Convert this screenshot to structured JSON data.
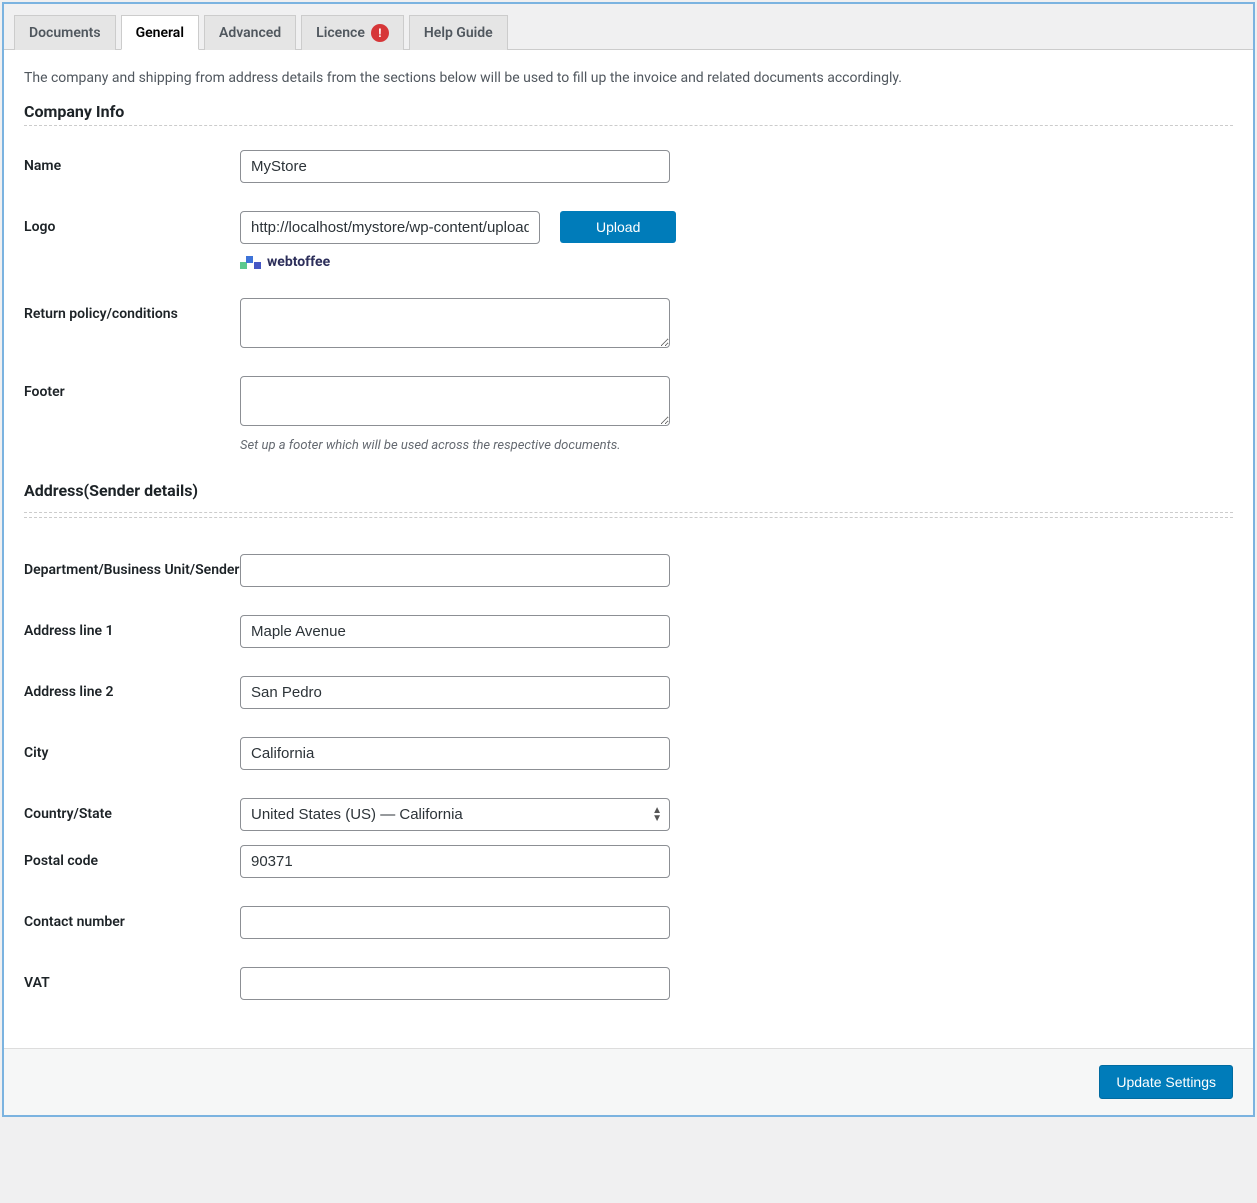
{
  "tabs": {
    "documents": "Documents",
    "general": "General",
    "advanced": "Advanced",
    "licence": "Licence",
    "licence_alert": "!",
    "help": "Help Guide"
  },
  "intro": "The company and shipping from address details from the sections below will be used to fill up the invoice and related documents accordingly.",
  "sections": {
    "company": "Company Info",
    "address": "Address(Sender details)"
  },
  "labels": {
    "name": "Name",
    "logo": "Logo",
    "return_policy": "Return policy/conditions",
    "footer": "Footer",
    "department": "Department/Business Unit/Sender",
    "address1": "Address line 1",
    "address2": "Address line 2",
    "city": "City",
    "country_state": "Country/State",
    "postal": "Postal code",
    "contact": "Contact number",
    "vat": "VAT"
  },
  "values": {
    "name": "MyStore",
    "logo_url": "http://localhost/mystore/wp-content/uploads",
    "return_policy": "",
    "footer": "",
    "department": "",
    "address1": "Maple Avenue",
    "address2": "San Pedro",
    "city": "California",
    "country_state": "United States (US) — California",
    "postal": "90371",
    "contact": "",
    "vat": ""
  },
  "logo_preview_text": "webtoffee",
  "help": {
    "footer": "Set up a footer which will be used across the respective documents."
  },
  "buttons": {
    "upload": "Upload",
    "update": "Update Settings"
  }
}
